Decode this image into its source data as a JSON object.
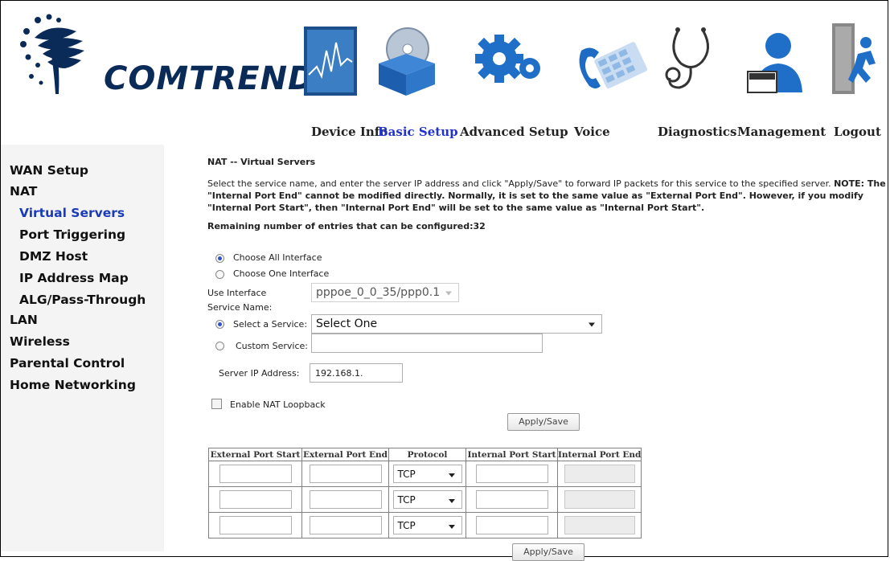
{
  "brand": {
    "name": "COMTREND"
  },
  "topnav": [
    {
      "label": "Device Info",
      "icon": "monitor-graph-icon"
    },
    {
      "label": "Basic Setup",
      "icon": "setup-box-disc-icon",
      "active": true
    },
    {
      "label": "Advanced Setup",
      "icon": "gear-icon"
    },
    {
      "label": "Voice",
      "icon": "phone-keypad-icon"
    },
    {
      "label": "Diagnostics",
      "icon": "stethoscope-icon"
    },
    {
      "label": "Management",
      "icon": "user-laptop-icon"
    },
    {
      "label": "Logout",
      "icon": "exit-door-icon"
    }
  ],
  "sidebar": {
    "items": [
      {
        "label": "WAN Setup",
        "level": 0
      },
      {
        "label": "NAT",
        "level": 0
      },
      {
        "label": "Virtual Servers",
        "level": 1,
        "active": true
      },
      {
        "label": "Port Triggering",
        "level": 1
      },
      {
        "label": "DMZ Host",
        "level": 1
      },
      {
        "label": "IP Address Map",
        "level": 1
      },
      {
        "label": "ALG/Pass-Through",
        "level": 1
      },
      {
        "label": "LAN",
        "level": 0
      },
      {
        "label": "Wireless",
        "level": 0
      },
      {
        "label": "Parental Control",
        "level": 0
      },
      {
        "label": "Home Networking",
        "level": 0
      }
    ]
  },
  "main": {
    "title": "NAT -- Virtual Servers",
    "description_1": "Select the service name, and enter the server IP address and click \"Apply/Save\" to forward IP packets for this service to the specified server. ",
    "note_label": "NOTE: The",
    "description_bold_1": "\"Internal Port End\" cannot be modified directly. Normally, it is set to the same value as \"External Port End\". However, if you modify \"Internal Port Start\", then \"Internal Port End\" will be set to the same value as \"Internal Port Start\".",
    "remaining": "Remaining number of entries that can be configured:32",
    "choose_all": "Choose All Interface",
    "choose_one": "Choose One Interface",
    "use_interface_label": "Use Interface",
    "use_interface_value": "pppoe_0_0_35/ppp0.1",
    "service_name_label": "Service Name:",
    "select_service_label": "Select a Service:",
    "select_service_value": "Select One",
    "custom_service_label": "Custom Service:",
    "custom_service_value": "",
    "server_ip_label": "Server IP Address:",
    "server_ip_value": "192.168.1.",
    "nat_loopback_label": "Enable NAT Loopback",
    "nat_loopback_checked": false,
    "apply_label": "Apply/Save",
    "choose_all_selected": true,
    "select_service_selected": true
  },
  "port_table": {
    "headers": [
      "External Port Start",
      "External Port End",
      "Protocol",
      "Internal Port Start",
      "Internal Port End"
    ],
    "rows": [
      {
        "ext_start": "",
        "ext_end": "",
        "protocol": "TCP",
        "int_start": "",
        "int_end": ""
      },
      {
        "ext_start": "",
        "ext_end": "",
        "protocol": "TCP",
        "int_start": "",
        "int_end": ""
      },
      {
        "ext_start": "",
        "ext_end": "",
        "protocol": "TCP",
        "int_start": "",
        "int_end": ""
      }
    ]
  },
  "colors": {
    "active_nav": "#2233cc",
    "active_side": "#1a3bb8",
    "brand": "#0a2a57"
  }
}
